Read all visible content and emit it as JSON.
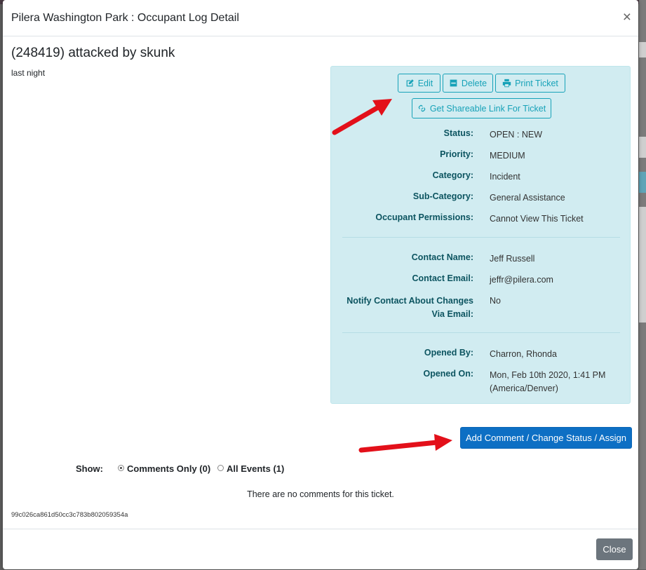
{
  "modal": {
    "title": "Pilera Washington Park : Occupant Log Detail",
    "close_symbol": "×"
  },
  "ticket": {
    "title": "(248419) attacked by skunk",
    "description": "last night"
  },
  "actions": {
    "edit_label": "Edit",
    "delete_label": "Delete",
    "print_label": "Print Ticket",
    "share_label": "Get Shareable Link For Ticket"
  },
  "details": {
    "status_label": "Status:",
    "status_value": "OPEN : NEW",
    "priority_label": "Priority:",
    "priority_value": "MEDIUM",
    "category_label": "Category:",
    "category_value": "Incident",
    "subcategory_label": "Sub-Category:",
    "subcategory_value": "General Assistance",
    "permissions_label": "Occupant Permissions:",
    "permissions_value": "Cannot View This Ticket",
    "contact_name_label": "Contact Name:",
    "contact_name_value": "Jeff Russell",
    "contact_email_label": "Contact Email:",
    "contact_email_value": "jeffr@pilera.com",
    "notify_label_1": "Notify Contact About Changes",
    "notify_label_2": "Via Email:",
    "notify_value": "No",
    "opened_by_label": "Opened By:",
    "opened_by_value": "Charron, Rhonda",
    "opened_on_label": "Opened On:",
    "opened_on_value_1": "Mon, Feb 10th 2020, 1:41 PM",
    "opened_on_value_2": "(America/Denver)"
  },
  "comment_button": "Add Comment / Change Status / Assign",
  "filter": {
    "show_label": "Show:",
    "comments_only": "Comments Only (0)",
    "all_events": "All Events (1)",
    "selected": "comments_only"
  },
  "no_comments_text": "There are no comments for this ticket.",
  "ticket_hash": "99c026ca861d50cc3c783b802059354a",
  "footer": {
    "close_label": "Close"
  },
  "icons": {
    "edit": "edit-icon",
    "delete": "minus-square-icon",
    "print": "print-icon",
    "link": "link-icon",
    "annotation": "red-arrow-icon"
  },
  "colors": {
    "panel_bg": "#d1ecf1",
    "label_text": "#0c5460",
    "outline_btn": "#17a2b8",
    "primary_btn": "#0d6fc4",
    "close_btn": "#6c757d",
    "annotation_arrow": "#e3101a"
  }
}
